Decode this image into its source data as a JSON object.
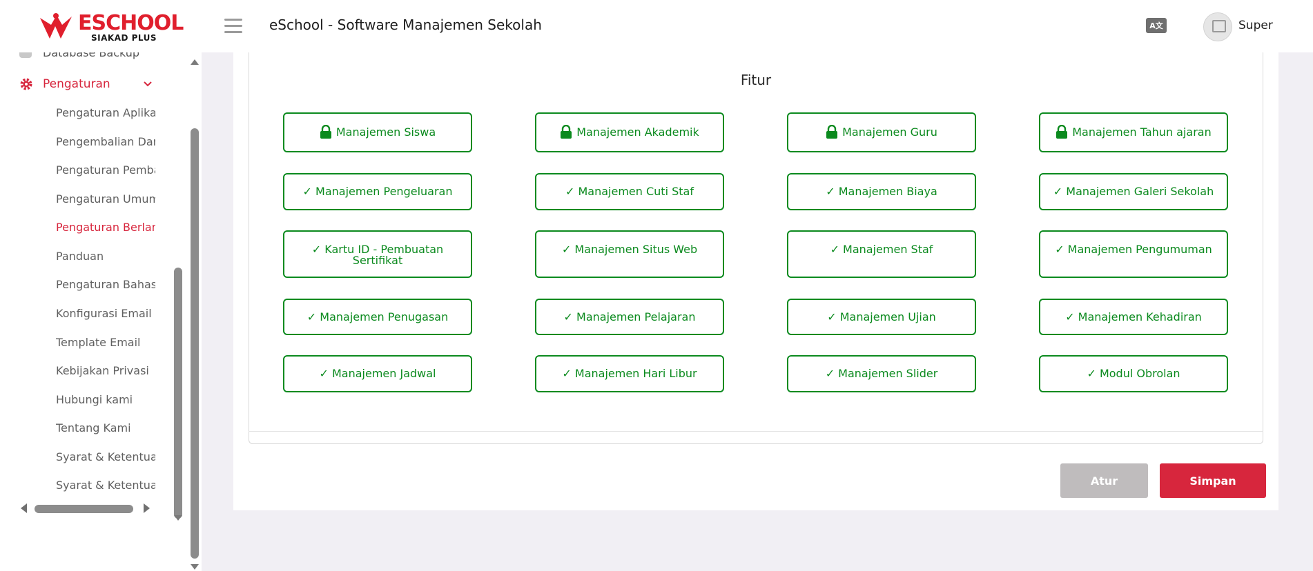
{
  "header": {
    "logo_title": "ESCHOOL",
    "logo_subtitle": "SIAKAD PLUS",
    "app_title": "eSchool - Software Manajemen Sekolah",
    "lang_icon_text": "A文",
    "user_name": "Super"
  },
  "sidebar": {
    "partial_item": "Database Backup",
    "parent": {
      "label": "Pengaturan",
      "icon": "gear-icon",
      "expanded": true
    },
    "items": [
      {
        "label": "Pengaturan Aplikasi"
      },
      {
        "label": "Pengembalian Dana"
      },
      {
        "label": "Pengaturan Pembayaran"
      },
      {
        "label": "Pengaturan Umum"
      },
      {
        "label": "Pengaturan Berlangganan",
        "active": true
      },
      {
        "label": "Panduan"
      },
      {
        "label": "Pengaturan Bahasa"
      },
      {
        "label": "Konfigurasi Email"
      },
      {
        "label": "Template Email"
      },
      {
        "label": "Kebijakan Privasi"
      },
      {
        "label": "Hubungi kami"
      },
      {
        "label": "Tentang Kami"
      },
      {
        "label": "Syarat & Ketentuan"
      },
      {
        "label": "Syarat & Ketentuan"
      }
    ]
  },
  "main": {
    "section_title": "Fitur",
    "features": [
      {
        "label": "Manajemen Siswa",
        "locked": true
      },
      {
        "label": "Manajemen Akademik",
        "locked": true
      },
      {
        "label": "Manajemen Guru",
        "locked": true
      },
      {
        "label": "Manajemen Tahun ajaran",
        "locked": true
      },
      {
        "label": "✓ Manajemen Pengeluaran",
        "locked": false
      },
      {
        "label": "✓ Manajemen Cuti Staf",
        "locked": false
      },
      {
        "label": "✓ Manajemen Biaya",
        "locked": false
      },
      {
        "label": "✓ Manajemen Galeri Sekolah",
        "locked": false
      },
      {
        "label": "✓ Kartu ID - Pembuatan Sertifikat",
        "locked": false
      },
      {
        "label": "✓ Manajemen Situs Web",
        "locked": false
      },
      {
        "label": "✓ Manajemen Staf",
        "locked": false
      },
      {
        "label": "✓ Manajemen Pengumuman",
        "locked": false
      },
      {
        "label": "✓ Manajemen Penugasan",
        "locked": false
      },
      {
        "label": "✓ Manajemen Pelajaran",
        "locked": false
      },
      {
        "label": "✓ Manajemen Ujian",
        "locked": false
      },
      {
        "label": "✓ Manajemen Kehadiran",
        "locked": false
      },
      {
        "label": "✓ Manajemen Jadwal",
        "locked": false
      },
      {
        "label": "✓ Manajemen Hari Libur",
        "locked": false
      },
      {
        "label": "✓ Manajemen Slider",
        "locked": false
      },
      {
        "label": "✓ Modul Obrolan",
        "locked": false
      }
    ],
    "buttons": {
      "reset": "Atur",
      "save": "Simpan"
    }
  },
  "colors": {
    "brand_red": "#d7263d",
    "feature_green": "#0b8a1e",
    "reset_gray": "#bfbcbd",
    "background": "#f1eff4"
  }
}
